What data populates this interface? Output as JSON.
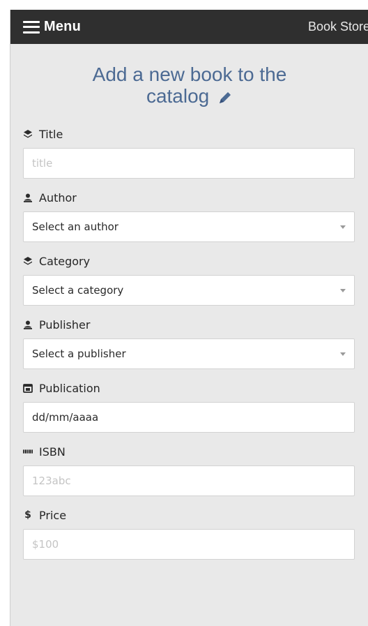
{
  "navbar": {
    "menu_label": "Menu",
    "brand": "Book Store"
  },
  "heading": {
    "line1": "Add a new book to the",
    "line2": "catalog"
  },
  "form": {
    "title": {
      "label": "Title",
      "placeholder": "title",
      "icon": "layers-icon"
    },
    "author": {
      "label": "Author",
      "selected": "Select an author",
      "icon": "user-icon"
    },
    "category": {
      "label": "Category",
      "selected": "Select a category",
      "icon": "layers-icon"
    },
    "publisher": {
      "label": "Publisher",
      "selected": "Select a publisher",
      "icon": "user-icon"
    },
    "publication": {
      "label": "Publication",
      "value": "dd/mm/aaaa",
      "icon": "calendar-icon"
    },
    "isbn": {
      "label": "ISBN",
      "placeholder": "123abc",
      "icon": "barcode-icon"
    },
    "price": {
      "label": "Price",
      "placeholder": "$100",
      "icon": "dollar-icon"
    }
  },
  "colors": {
    "navbar_bg": "#2f2f2f",
    "page_bg": "#e9e9e9",
    "heading": "#4c6a93",
    "placeholder": "#c4c4c4"
  }
}
